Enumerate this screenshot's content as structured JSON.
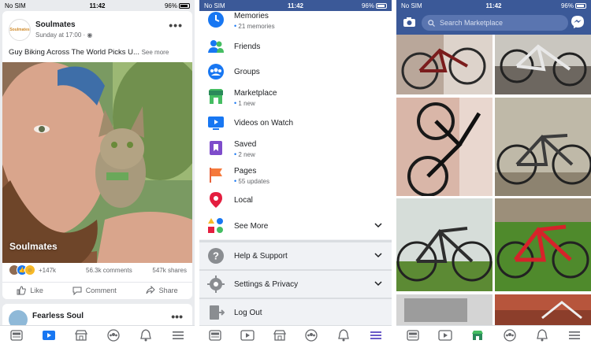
{
  "status": {
    "carrier": "No SIM",
    "time": "11:42",
    "battery": "96%"
  },
  "feed": {
    "post": {
      "author": "Soulmates",
      "avatar_text": "Soulmates",
      "time": "Sunday at 17:00",
      "text": "Guy Biking Across The World Picks U...",
      "see_more": "See more",
      "watermark": "Soulmates",
      "reactions": "+147k",
      "comments": "56.3k comments",
      "shares": "547k shares",
      "actions": {
        "like": "Like",
        "comment": "Comment",
        "share": "Share"
      }
    },
    "next_post": {
      "author": "Fearless Soul"
    }
  },
  "menu": {
    "items": [
      {
        "label": "Memories",
        "sub": "21 memories"
      },
      {
        "label": "Friends",
        "sub": ""
      },
      {
        "label": "Groups",
        "sub": ""
      },
      {
        "label": "Marketplace",
        "sub": "1 new"
      },
      {
        "label": "Videos on Watch",
        "sub": ""
      },
      {
        "label": "Saved",
        "sub": "2 new"
      },
      {
        "label": "Pages",
        "sub": "55 updates"
      },
      {
        "label": "Local",
        "sub": ""
      },
      {
        "label": "See More",
        "sub": ""
      }
    ],
    "help": "Help & Support",
    "settings": "Settings & Privacy",
    "logout": "Log Out"
  },
  "marketplace": {
    "search_placeholder": "Search Marketplace"
  },
  "colors": {
    "fb_blue": "#3b5998",
    "accent": "#1877f2",
    "active_tab_p1": "#1877f2",
    "active_tab_p2": "#6b5bc8",
    "active_tab_p3": "#2b8a5a"
  }
}
